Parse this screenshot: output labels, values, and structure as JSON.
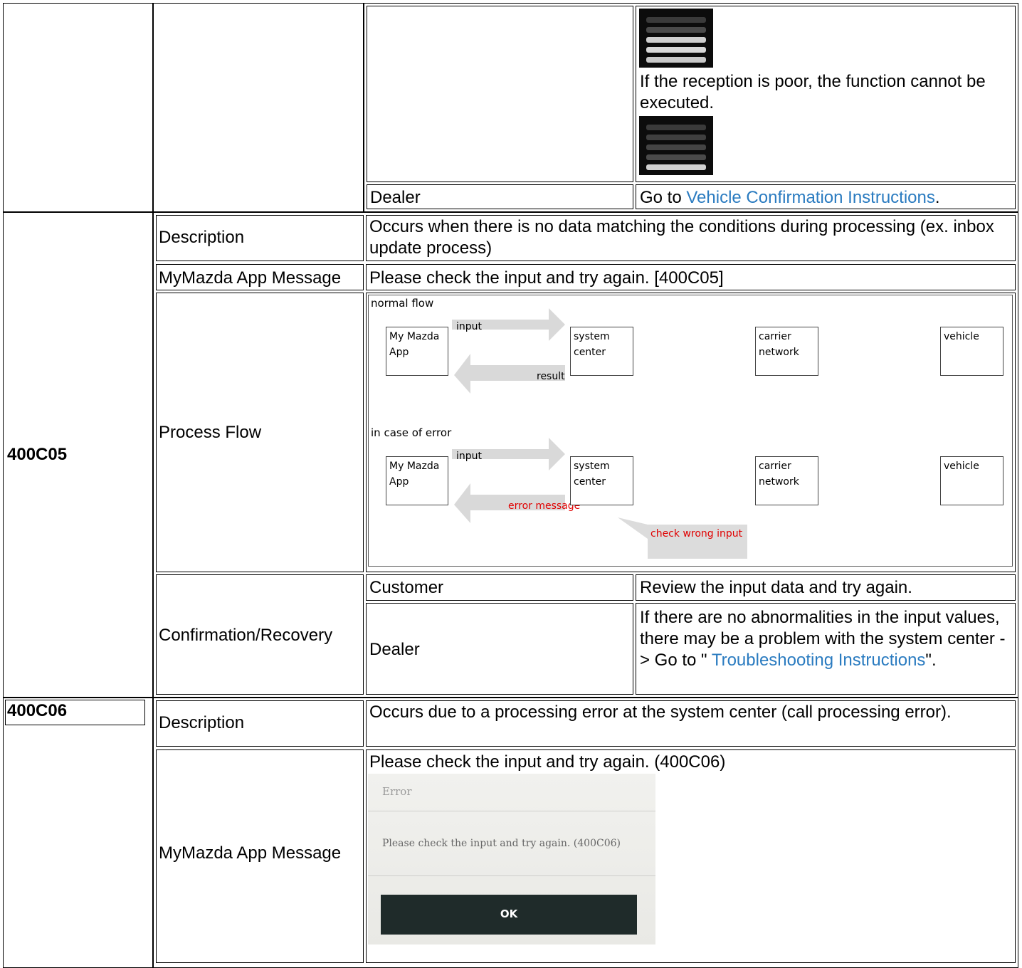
{
  "top_block": {
    "reception_text": "If the reception is poor, the function cannot be executed.",
    "dealer_label": "Dealer",
    "dealer_text_prefix": "Go to ",
    "dealer_link": "Vehicle Confirmation Instructions",
    "dealer_text_suffix": "."
  },
  "code_400C05": {
    "code": "400C05",
    "description_label": "Description",
    "description_text": "Occurs when there is no data matching the conditions during processing (ex. inbox update process)",
    "app_message_label": "MyMazda App Message",
    "app_message_text": "Please check the input and try again. [400C05]",
    "process_flow_label": "Process Flow",
    "flow": {
      "normal_title": "normal flow",
      "error_title": "in case of error",
      "node_app_line1": "My Mazda",
      "node_app_line2": "App",
      "node_center_line1": "system",
      "node_center_line2": "center",
      "node_carrier_line1": "carrier",
      "node_carrier_line2": "network",
      "node_vehicle": "vehicle",
      "arrow_input": "input",
      "arrow_result": "result",
      "arrow_error": "error message",
      "callout": "check wrong input",
      "error_color": "#e00000"
    },
    "confirmation_label": "Confirmation/Recovery",
    "customer_label": "Customer",
    "customer_text": "Review the input data and try again.",
    "dealer_label": "Dealer",
    "dealer_text_prefix": "If there are no abnormalities in the input values, there may be a problem with the system center -> Go to \" ",
    "dealer_link": "Troubleshooting Instructions",
    "dealer_text_suffix": "\"."
  },
  "code_400C06": {
    "code": "400C06",
    "description_label": "Description",
    "description_text": "Occurs due to a processing error at the system center (call processing error).",
    "app_message_label": "MyMazda App Message",
    "app_message_text": "Please check the input and try again. (400C06)",
    "dialog": {
      "title": "Error",
      "message": "Please check the input and try again. (400C06)",
      "button": "OK"
    }
  }
}
